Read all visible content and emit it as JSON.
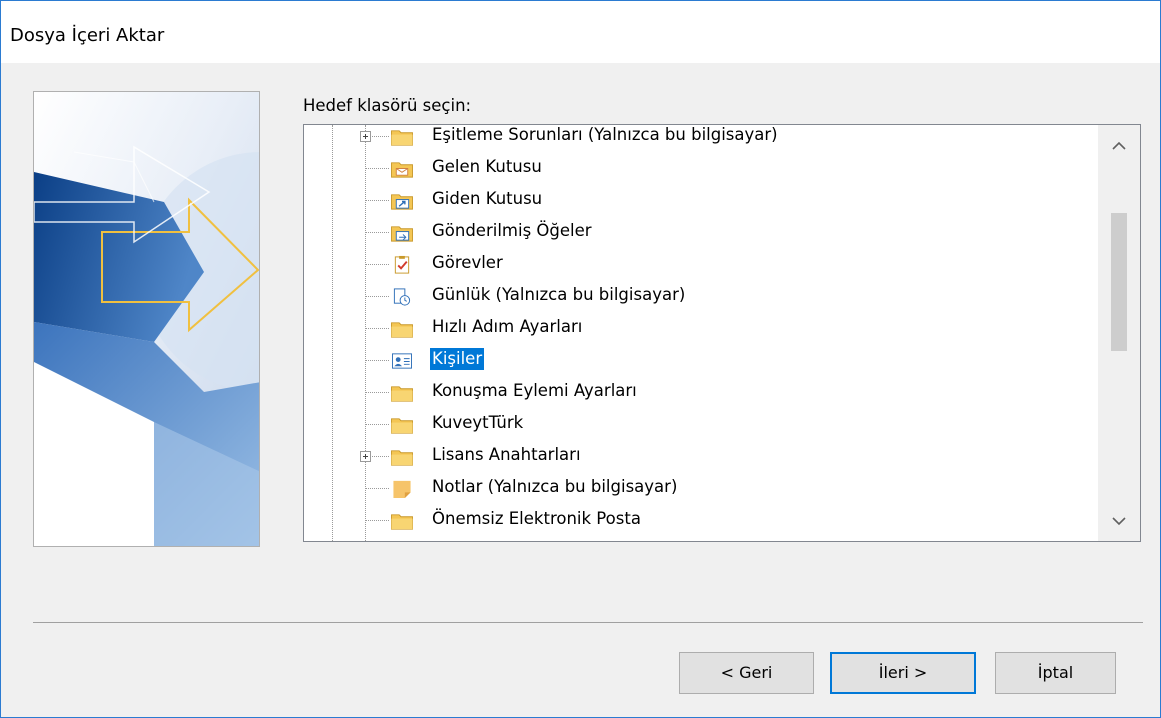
{
  "window": {
    "title": "Dosya İçeri Aktar"
  },
  "prompt": {
    "label": "Hedef klasörü seçin:"
  },
  "tree": {
    "items": [
      {
        "label": "Eşitleme Sorunları (Yalnızca bu bilgisayar)",
        "icon": "folder-icon",
        "expandable": true,
        "selected": false
      },
      {
        "label": "Gelen Kutusu",
        "icon": "inbox-icon",
        "expandable": false,
        "selected": false
      },
      {
        "label": "Giden Kutusu",
        "icon": "outbox-icon",
        "expandable": false,
        "selected": false
      },
      {
        "label": "Gönderilmiş Öğeler",
        "icon": "sent-items-icon",
        "expandable": false,
        "selected": false
      },
      {
        "label": "Görevler",
        "icon": "tasks-icon",
        "expandable": false,
        "selected": false
      },
      {
        "label": "Günlük (Yalnızca bu bilgisayar)",
        "icon": "journal-icon",
        "expandable": false,
        "selected": false
      },
      {
        "label": "Hızlı Adım Ayarları",
        "icon": "folder-icon",
        "expandable": false,
        "selected": false
      },
      {
        "label": "Kişiler",
        "icon": "contacts-icon",
        "expandable": false,
        "selected": true
      },
      {
        "label": "Konuşma Eylemi Ayarları",
        "icon": "folder-icon",
        "expandable": false,
        "selected": false
      },
      {
        "label": "KuveytTürk",
        "icon": "folder-icon",
        "expandable": false,
        "selected": false
      },
      {
        "label": "Lisans Anahtarları",
        "icon": "folder-icon",
        "expandable": true,
        "selected": false
      },
      {
        "label": "Notlar (Yalnızca bu bilgisayar)",
        "icon": "notes-icon",
        "expandable": false,
        "selected": false
      },
      {
        "label": "Önemsiz Elektronik Posta",
        "icon": "folder-icon",
        "expandable": false,
        "selected": false
      }
    ]
  },
  "scrollbar": {
    "up_glyph": "⌃",
    "down_glyph": "⌄",
    "position_fraction": 0.2
  },
  "buttons": {
    "back": "< Geri",
    "next": "İleri >",
    "cancel": "İptal"
  },
  "colors": {
    "accent": "#0078d7",
    "window_border": "#2b7bd1",
    "folder": "#f4c654"
  }
}
